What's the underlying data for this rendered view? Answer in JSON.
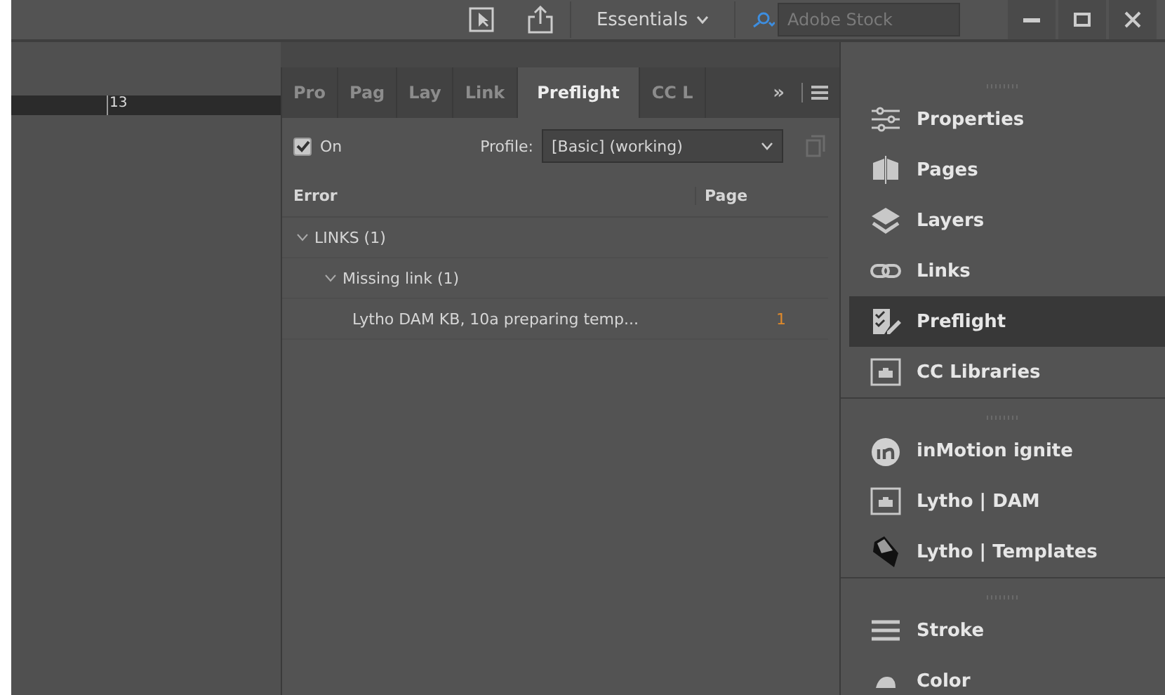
{
  "top_bar": {
    "workspace": "Essentials",
    "search": {
      "placeholder": "Adobe Stock"
    }
  },
  "ruler": {
    "label": "13"
  },
  "preflight_panel": {
    "tabs": [
      {
        "label": "Pro",
        "selected": false
      },
      {
        "label": "Pag",
        "selected": false
      },
      {
        "label": "Lay",
        "selected": false
      },
      {
        "label": "Link",
        "selected": false
      },
      {
        "label": "Preflight",
        "selected": true
      },
      {
        "label": "CC L",
        "selected": false
      }
    ],
    "overflow": "»",
    "on": {
      "label": "On",
      "checked": true
    },
    "profile": {
      "label": "Profile:",
      "value": "[Basic] (working)"
    },
    "columns": [
      "Error",
      "Page"
    ],
    "tree": [
      {
        "label": "LINKS (1)",
        "expanded": true,
        "children": [
          {
            "label": "Missing link (1)",
            "expanded": true,
            "children": [
              {
                "label": "Lytho DAM KB, 10a preparing temp...",
                "page": "1"
              }
            ]
          }
        ]
      }
    ]
  },
  "dock": {
    "groups": [
      {
        "items": [
          {
            "label": "Properties",
            "selected": false
          },
          {
            "label": "Pages",
            "selected": false
          },
          {
            "label": "Layers",
            "selected": false
          },
          {
            "label": "Links",
            "selected": false
          },
          {
            "label": "Preflight",
            "selected": true
          },
          {
            "label": "CC Libraries",
            "selected": false
          }
        ]
      },
      {
        "items": [
          {
            "label": "inMotion ignite",
            "selected": false
          },
          {
            "label": "Lytho | DAM",
            "selected": false
          },
          {
            "label": "Lytho | Templates",
            "selected": false
          }
        ]
      },
      {
        "items": [
          {
            "label": "Stroke",
            "selected": false
          },
          {
            "label": "Color",
            "selected": false
          }
        ]
      }
    ]
  }
}
